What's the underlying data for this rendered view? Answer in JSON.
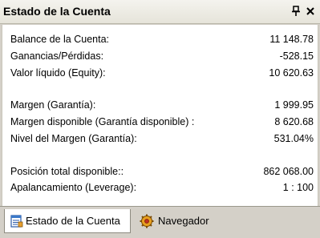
{
  "window": {
    "title": "Estado de la Cuenta"
  },
  "rows": [
    {
      "label": "Balance de la Cuenta:",
      "value": "11 148.78"
    },
    {
      "label": "Ganancias/Pérdidas:",
      "value": "-528.15"
    },
    {
      "label": "Valor líquido (Equity):",
      "value": "10 620.63"
    },
    {
      "label": "Margen (Garantía):",
      "value": "1 999.95"
    },
    {
      "label": "Margen disponible (Garantía disponible) :",
      "value": "8 620.68"
    },
    {
      "label": "Nivel del Margen (Garantía):",
      "value": "531.04%"
    },
    {
      "label": "Posición total disponible::",
      "value": "862 068.00"
    },
    {
      "label": "Apalancamiento (Leverage):",
      "value": "1 : 100"
    }
  ],
  "tabs": [
    {
      "label": "Estado de la Cuenta",
      "icon": "account-status-icon",
      "active": true
    },
    {
      "label": "Navegador",
      "icon": "navigator-gear-icon",
      "active": false
    }
  ],
  "colors": {
    "panel_bg": "#d4d0c8",
    "content_bg": "#ffffff"
  }
}
